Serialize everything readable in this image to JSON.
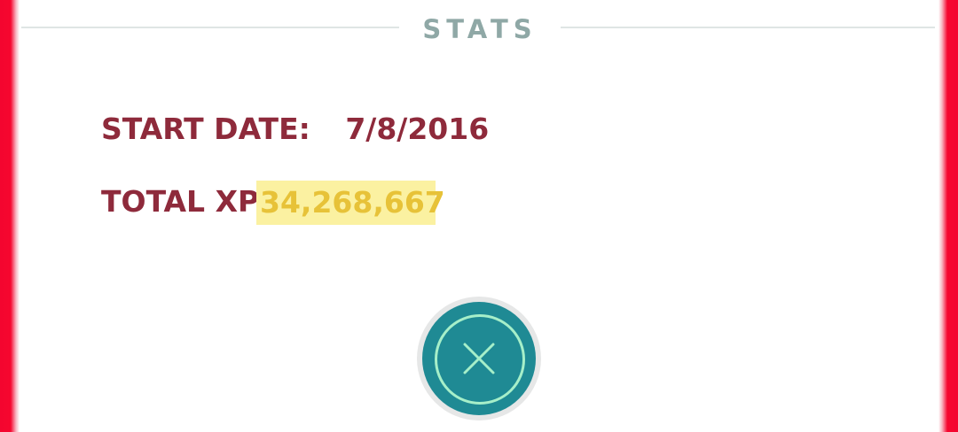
{
  "header": {
    "title": "STATS"
  },
  "stats": {
    "start_date_label": "START DATE:",
    "start_date_value": "7/8/2016",
    "total_xp_label": "TOTAL XP",
    "total_xp_value": "34,268,667"
  },
  "close_button": {
    "icon": "close-icon"
  },
  "colors": {
    "frame": "#f4052f",
    "label": "#8e2a3b",
    "title": "#8fa8a6",
    "xp_text": "#e7c238",
    "xp_highlight": "#fbf1a1",
    "button": "#1f8a94",
    "button_ring": "#a6efc9"
  }
}
